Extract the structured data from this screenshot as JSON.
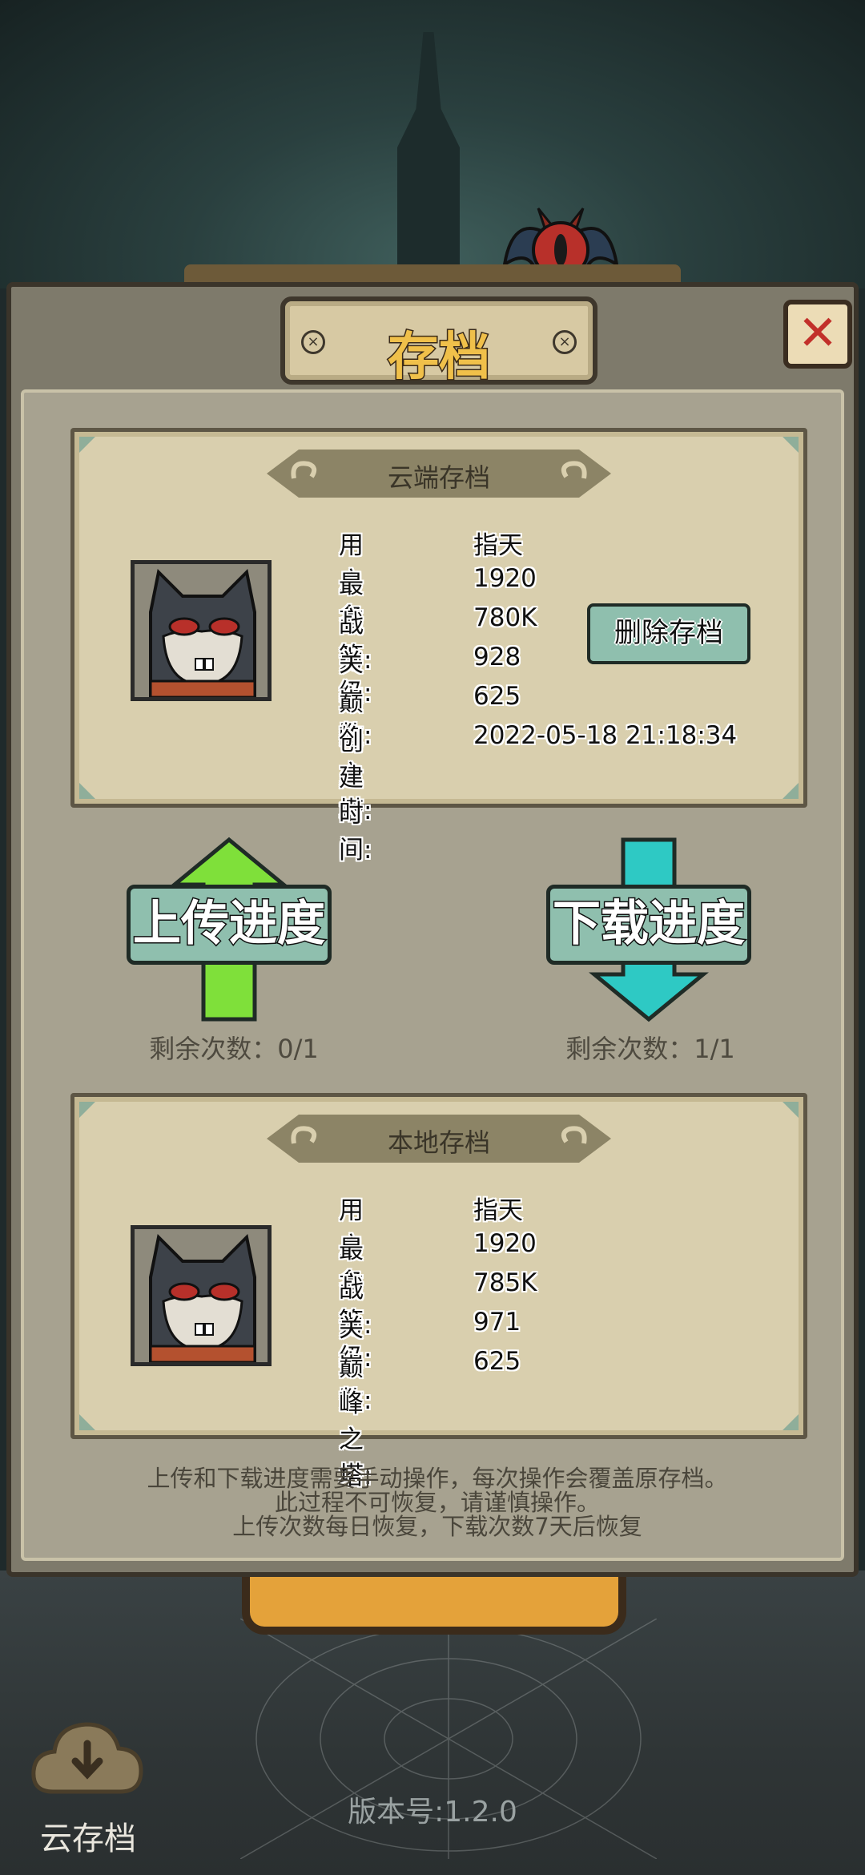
{
  "dialog": {
    "title": "存档",
    "close_symbol": "✕",
    "delete_button_label": "删除存档"
  },
  "cloud_save": {
    "banner": "云端存档",
    "stats": [
      {
        "label": "用户名",
        "value": "指天"
      },
      {
        "label": "最高等级:",
        "value": "1920"
      },
      {
        "label": "战力:",
        "value": "780K"
      },
      {
        "label": "关卡数:",
        "value": "928"
      },
      {
        "label": "巅峰之塔:",
        "value": "625"
      },
      {
        "label": "创建时间:",
        "value": "2022-05-18 21:18:34"
      }
    ]
  },
  "upload": {
    "label": "上传进度",
    "remaining": "剩余次数：0/1",
    "arrow_color": "#7fe03a"
  },
  "download": {
    "label": "下载进度",
    "remaining": "剩余次数：1/1",
    "arrow_color": "#2ec9c4"
  },
  "local_save": {
    "banner": "本地存档",
    "stats": [
      {
        "label": "用户名",
        "value": "指天"
      },
      {
        "label": "最高等级:",
        "value": "1920"
      },
      {
        "label": "战力:",
        "value": "785K"
      },
      {
        "label": "关卡数:",
        "value": "971"
      },
      {
        "label": "巅峰之塔:",
        "value": "625"
      }
    ]
  },
  "notice": [
    "上传和下载进度需要手动操作，每次操作会覆盖原存档。",
    "此过程不可恢复，请谨慎操作。",
    "上传次数每日恢复，下载次数7天后恢复"
  ],
  "footer": {
    "cloud_save_label": "云存档",
    "version": "版本号:1.2.0"
  }
}
